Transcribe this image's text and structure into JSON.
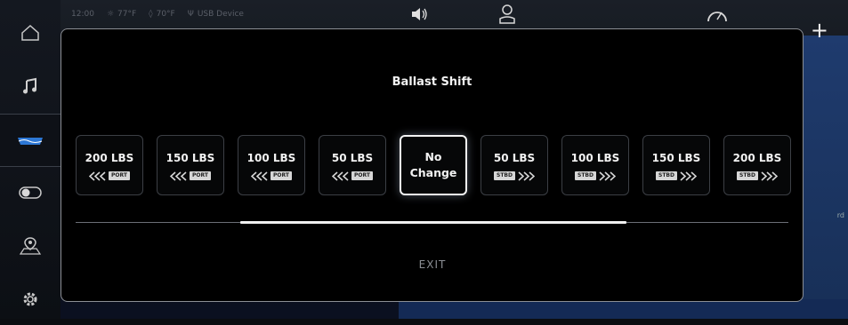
{
  "status": {
    "time": "12:00",
    "outside_temp": "77°F",
    "water_temp": "70°F",
    "usb": "USB Device"
  },
  "modal": {
    "title": "Ballast Shift",
    "exit_label": "EXIT",
    "options": [
      {
        "label": "200 LBS",
        "side": "PORT"
      },
      {
        "label": "150 LBS",
        "side": "PORT"
      },
      {
        "label": "100 LBS",
        "side": "PORT"
      },
      {
        "label": "50 LBS",
        "side": "PORT"
      },
      {
        "label": "No\nChange",
        "side": ""
      },
      {
        "label": "50 LBS",
        "side": "STBD"
      },
      {
        "label": "100 LBS",
        "side": "STBD"
      },
      {
        "label": "150 LBS",
        "side": "STBD"
      },
      {
        "label": "200 LBS",
        "side": "STBD"
      }
    ],
    "selected_index": 4
  },
  "background": {
    "plus_label": "+",
    "partial_label": "rd"
  },
  "colors": {
    "accent": "#ffffff",
    "modal_border": "#8c8f95",
    "tag_bg": "#d6d6d6"
  },
  "icons": {
    "sidebar": [
      "home-icon",
      "music-icon",
      "boat-icon",
      "toggle-icon",
      "map-pin-icon",
      "gear-icon"
    ]
  }
}
